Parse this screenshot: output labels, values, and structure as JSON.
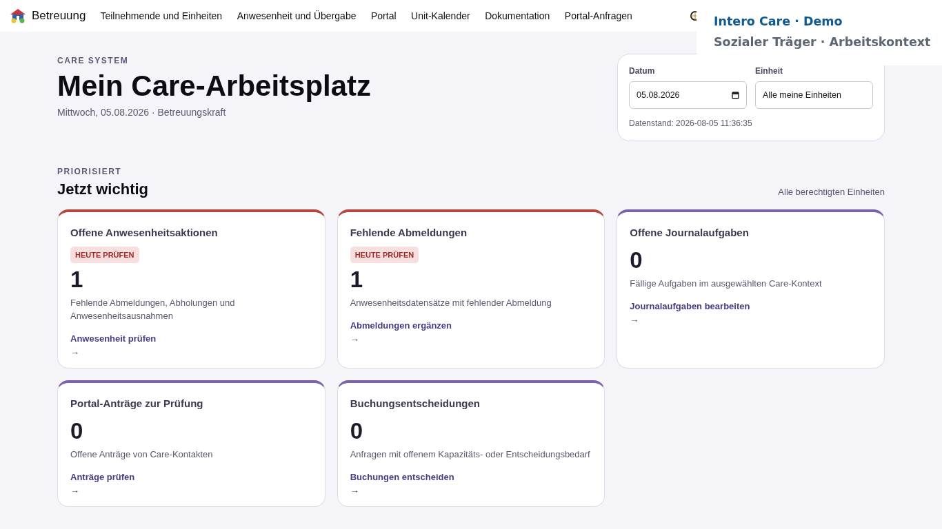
{
  "nav": {
    "brand": "Betreuung",
    "items": [
      "Teilnehmende und Einheiten",
      "Anwesenheit und Übergabe",
      "Portal",
      "Unit-Kalender",
      "Dokumentation",
      "Portal-Anfragen"
    ]
  },
  "context_panel": {
    "title": "Intero Care · Demo",
    "subtitle": "Sozialer Träger · Arbeitskontext"
  },
  "header": {
    "eyebrow": "CARE SYSTEM",
    "title": "Mein Care-Arbeitsplatz",
    "subtitle": "Mittwoch, 05.08.2026 · Betreuungskraft"
  },
  "filters": {
    "date_label": "Datum",
    "date_value": "05.08.2026",
    "unit_label": "Einheit",
    "unit_value": "Alle meine Einheiten",
    "timestamp": "Datenstand: 2026-08-05 11:36:35"
  },
  "section": {
    "eyebrow": "PRIORISIERT",
    "title": "Jetzt wichtig",
    "scope": "Alle berechtigten Einheiten"
  },
  "cards": [
    {
      "title": "Offene Anwesenheitsaktionen",
      "color": "#b5453d",
      "badge": "HEUTE PRÜFEN",
      "count": "1",
      "description": "Fehlende Abmeldungen, Abholungen und Anwesenheitsausnahmen",
      "link": "Anwesenheit prüfen",
      "arrow": "→"
    },
    {
      "title": "Fehlende Abmeldungen",
      "color": "#b5453d",
      "badge": "HEUTE PRÜFEN",
      "count": "1",
      "description": "Anwesenheitsdatensätze mit fehlender Abmeldung",
      "link": "Abmeldungen ergänzen",
      "arrow": "→"
    },
    {
      "title": "Offene Journalaufgaben",
      "color": "#7a62aa",
      "count": "0",
      "description": "Fällige Aufgaben im ausgewählten Care-Kontext",
      "link": "Journalaufgaben bearbeiten",
      "arrow": "→"
    },
    {
      "title": "Portal-Anträge zur Prüfung",
      "color": "#7a62aa",
      "count": "0",
      "description": "Offene Anträge von Care-Kontakten",
      "link": "Anträge prüfen",
      "arrow": "→"
    },
    {
      "title": "Buchungsentscheidungen",
      "color": "#7a62aa",
      "count": "0",
      "description": "Anfragen mit offenem Kapazitäts- oder Entscheidungsbedarf",
      "link": "Buchungen entscheiden",
      "arrow": "→"
    }
  ]
}
